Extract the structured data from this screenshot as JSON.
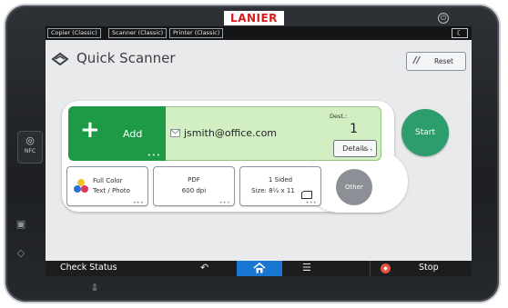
{
  "device": {
    "brand": "LANIER"
  },
  "function_tabs": [
    {
      "label": "Copier (Classic)"
    },
    {
      "label": "Scanner (Classic)"
    },
    {
      "label": "Printer (Classic)"
    }
  ],
  "header": {
    "title": "Quick Scanner",
    "reset_label": "Reset"
  },
  "destination": {
    "add_label": "Add",
    "email": "jsmith@office.com",
    "dest_label": "Dest.:",
    "dest_count": "1",
    "details_label": "Details"
  },
  "scan_options": {
    "color": {
      "line1": "Full Color",
      "line2": "Text / Photo"
    },
    "format": {
      "line1": "PDF",
      "line2": "600 dpi"
    },
    "sides": {
      "line1": "1 Sided",
      "line2": "Size: 8½ x 11"
    },
    "other_label": "Other"
  },
  "start_label": "Start",
  "bottom_bar": {
    "check_status": "Check Status",
    "stop_label": "Stop"
  },
  "colors": {
    "add_green": "#1e9a47",
    "dest_bg": "#d2eec3",
    "start_green": "#2d9d6e",
    "home_blue": "#1976d2",
    "brand_red": "#d51c1c"
  },
  "icons": [
    "power-icon",
    "nfc-icon",
    "scanner-icon",
    "reset-icon",
    "plus-icon",
    "mail-icon",
    "color-icon",
    "orientation-icon",
    "back-icon",
    "home-icon",
    "menu-icon",
    "stop-icon",
    "moon-icon"
  ]
}
